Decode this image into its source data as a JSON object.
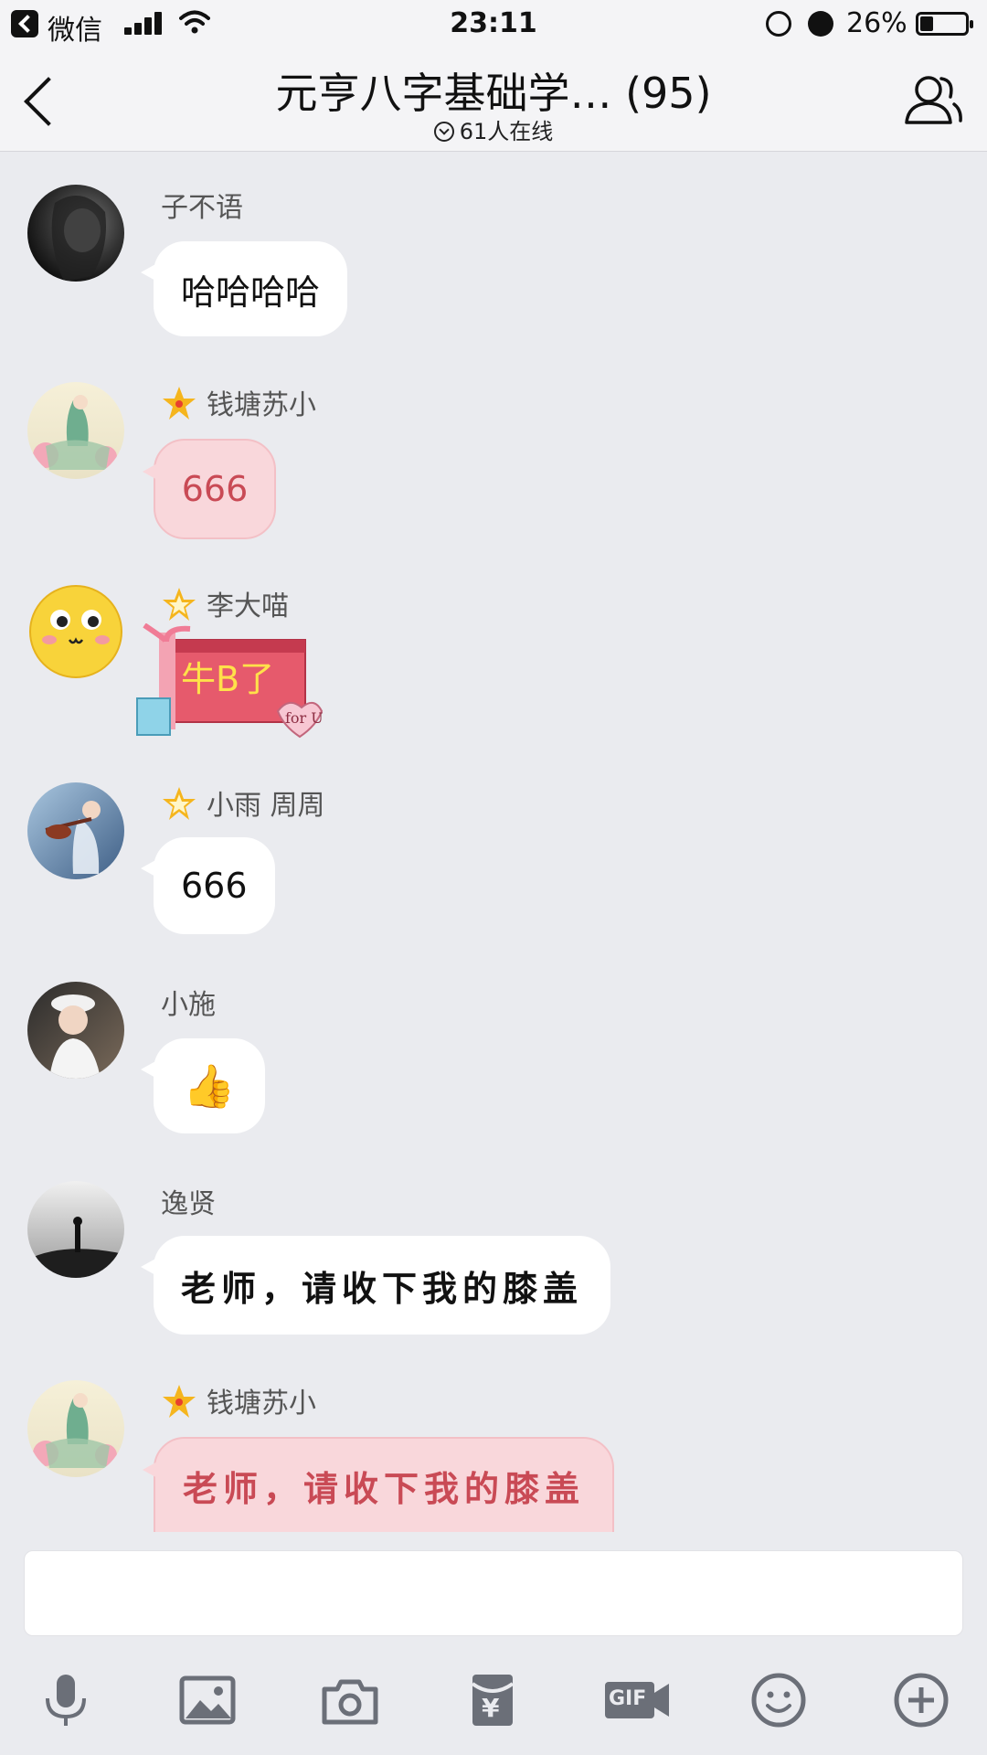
{
  "status_bar": {
    "app": "微信",
    "time": "23:11",
    "battery": "26%",
    "battery_level": 0.26
  },
  "header": {
    "title": "元亨八字基础学… (95)",
    "online": "61人在线"
  },
  "messages": [
    {
      "sender": "子不语",
      "text": "哈哈哈哈",
      "style": "plain",
      "badge": null
    },
    {
      "sender": "钱塘苏小",
      "text": "666",
      "style": "pink",
      "badge": "star"
    },
    {
      "sender": "李大喵",
      "text": "牛B了",
      "style": "gift-sticker",
      "badge": "star-outline",
      "sticker_note": "for U"
    },
    {
      "sender": "小雨 周周",
      "text": "666",
      "style": "plain",
      "badge": "star-outline"
    },
    {
      "sender": "小施",
      "text": "👍",
      "style": "plain",
      "badge": null
    },
    {
      "sender": "逸贤",
      "text": "老师，请收下我的膝盖",
      "style": "handwrite",
      "badge": null
    },
    {
      "sender": "钱塘苏小",
      "text": "老师，请收下我的膝盖",
      "style": "pink-handwrite",
      "badge": "star"
    }
  ],
  "input": {
    "placeholder": ""
  },
  "toolbar": {
    "items": [
      "mic-icon",
      "image-icon",
      "camera-icon",
      "red-packet-icon",
      "gif-icon",
      "emoji-icon",
      "plus-icon"
    ],
    "gif_label": "GIF",
    "red_packet_label": "¥"
  },
  "colors": {
    "background": "#eaebef",
    "bar": "#f4f4f6",
    "pink_bubble": "#f9d7db",
    "pink_text": "#c94a55",
    "star": "#f5b51d",
    "icon_gray": "#6b6f78"
  }
}
